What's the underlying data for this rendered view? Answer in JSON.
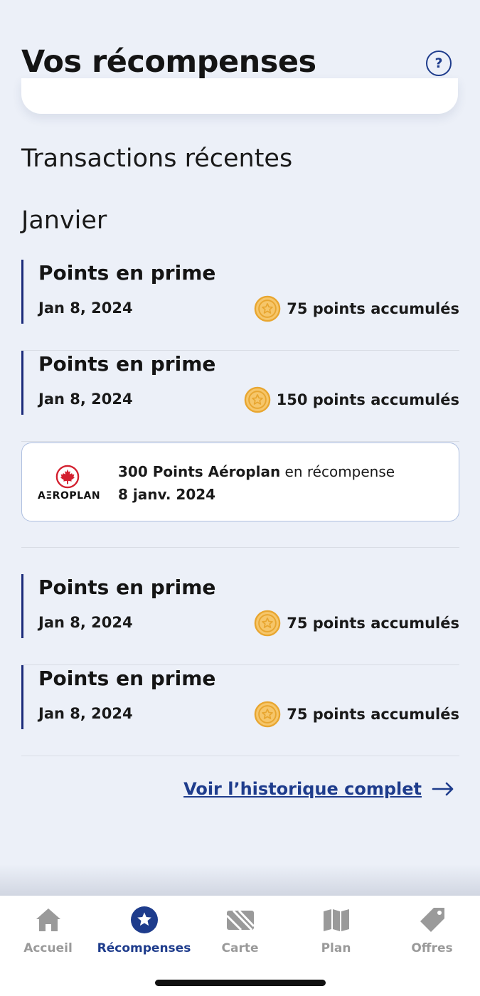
{
  "header": {
    "title": "Vos récompenses",
    "help_icon": "question-circle-icon",
    "help_glyph": "?"
  },
  "transactions": {
    "section_title": "Transactions récentes",
    "month": "Janvier",
    "items": [
      {
        "title": "Points en prime",
        "date": "Jan 8, 2024",
        "points": "75 points accumulés"
      },
      {
        "title": "Points en prime",
        "date": "Jan 8, 2024",
        "points": "150 points accumulés"
      },
      {
        "title": "Points en prime",
        "date": "Jan 8, 2024",
        "points": "75 points accumulés"
      },
      {
        "title": "Points en prime",
        "date": "Jan 8, 2024",
        "points": "75 points accumulés"
      }
    ],
    "aeroplan": {
      "logo_text": "AΞROPLAN",
      "amount": "300 Points Aéroplan",
      "suffix": " en récompense",
      "date": "8 janv. 2024"
    },
    "history_link": "Voir l’historique complet"
  },
  "nav": {
    "items": [
      {
        "label": "Accueil",
        "icon": "home-icon",
        "active": false
      },
      {
        "label": "Récompenses",
        "icon": "star-icon",
        "active": true
      },
      {
        "label": "Carte",
        "icon": "card-icon",
        "active": false
      },
      {
        "label": "Plan",
        "icon": "map-icon",
        "active": false
      },
      {
        "label": "Offres",
        "icon": "tag-icon",
        "active": false
      }
    ]
  },
  "colors": {
    "background": "#ECF0F8",
    "primary": "#1E3C8C",
    "accent_bar": "#1B2B7A",
    "coin": "#E8A630",
    "aeroplan_red": "#D3202F",
    "inactive": "#9A9A9A"
  }
}
